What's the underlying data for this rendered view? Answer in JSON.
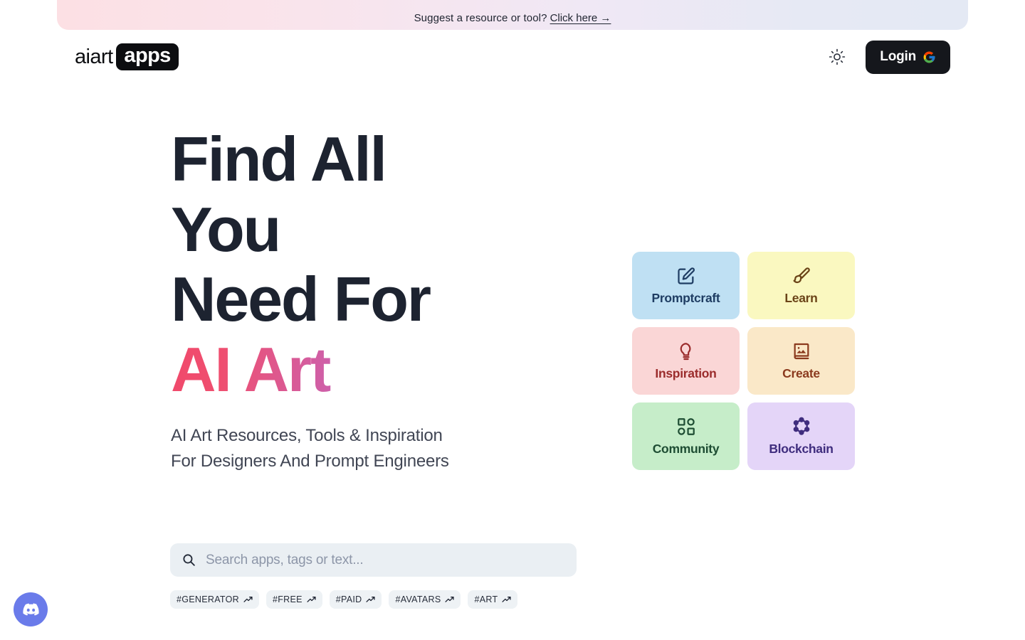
{
  "banner": {
    "text": "Suggest a resource or tool?",
    "link_label": "Click here →"
  },
  "header": {
    "logo_word": "aiart",
    "logo_badge": "apps",
    "theme_toggle_icon": "sun-icon",
    "login_label": "Login",
    "login_provider_icon": "google-g-icon"
  },
  "hero": {
    "line1": "Find All",
    "line2": "You",
    "line3": "Need For",
    "accent": "AI Art",
    "subtitle_line1": "AI Art Resources, Tools & Inspiration",
    "subtitle_line2": "For Designers And Prompt Engineers",
    "accent_gradient_start": "#f0496b",
    "accent_gradient_mid": "#a066d2",
    "accent_gradient_end": "#4a80cf",
    "title_color": "#1d2330"
  },
  "search": {
    "placeholder": "Search apps, tags or text...",
    "value": "",
    "icon": "search-icon",
    "background": "#eaeff3"
  },
  "tags": [
    {
      "label": "#GENERATOR",
      "icon": "trending-up-icon"
    },
    {
      "label": "#FREE",
      "icon": "trending-up-icon"
    },
    {
      "label": "#PAID",
      "icon": "trending-up-icon"
    },
    {
      "label": "#AVATARS",
      "icon": "trending-up-icon"
    },
    {
      "label": "#ART",
      "icon": "trending-up-icon"
    }
  ],
  "categories": [
    {
      "label": "Promptcraft",
      "icon": "edit-square-icon",
      "bg": "#bfe0f3",
      "fg": "#1f3d63"
    },
    {
      "label": "Learn",
      "icon": "paintbrush-icon",
      "bg": "#faf8c0",
      "fg": "#6b4418"
    },
    {
      "label": "Inspiration",
      "icon": "lightbulb-icon",
      "bg": "#fad6d6",
      "fg": "#9b2c2c"
    },
    {
      "label": "Create",
      "icon": "photo-album-icon",
      "bg": "#fae8c8",
      "fg": "#8b3a1e"
    },
    {
      "label": "Community",
      "icon": "shapes-grid-icon",
      "bg": "#c6edc9",
      "fg": "#1e4d33"
    },
    {
      "label": "Blockchain",
      "icon": "network-nodes-icon",
      "bg": "#e4d5f8",
      "fg": "#3f2d7e"
    }
  ],
  "chat_widget": {
    "icon": "discord-icon",
    "color": "#6a7bea"
  }
}
